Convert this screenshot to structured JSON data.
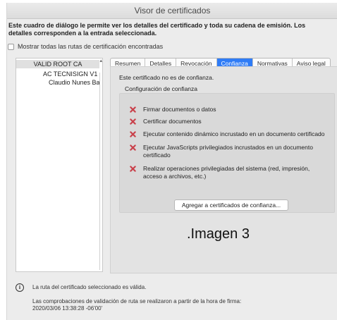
{
  "window": {
    "title": "Visor de certificados"
  },
  "intro": "Este cuadro de diálogo le permite ver los detalles del certificado y toda su cadena de emisión. Los detalles corresponden a la entrada seleccionada.",
  "show_all_paths": {
    "label": "Mostrar todas las rutas de certificación encontradas",
    "checked": false
  },
  "tree": {
    "nodes": [
      "VALID ROOT CA",
      "AC TECNISIGN V1",
      "Claudio Nunes Ba"
    ]
  },
  "tabs": [
    {
      "label": "Resumen",
      "active": false
    },
    {
      "label": "Detalles",
      "active": false
    },
    {
      "label": "Revocación",
      "active": false
    },
    {
      "label": "Confianza",
      "active": true
    },
    {
      "label": "Normativas",
      "active": false
    },
    {
      "label": "Aviso legal",
      "active": false
    }
  ],
  "trust": {
    "not_trusted": "Este certificado no es de confianza.",
    "config_label": "Configuración de confianza",
    "items": [
      "Firmar documentos o datos",
      "Certificar documentos",
      "Ejecutar contenido dinámico incrustado en un documento certificado",
      "Ejecutar JavaScripts privilegiados incrustados en un documento certificado",
      "Realizar operaciones privilegiadas del sistema (red, impresión, acceso a archivos, etc.)"
    ],
    "item_icon": "red-x-icon",
    "add_button": "Agregar a certificados de confianza..."
  },
  "caption": ".Imagen 3",
  "status": {
    "icon": "info-icon",
    "valid": "La ruta del certificado seleccionado es válida.",
    "checks": "Las comprobaciones de validación de ruta se realizaron a partir de la hora de firma: 2020/03/06 13:38:28 -06'00'"
  },
  "colors": {
    "accent": "#2f7cf6",
    "x_mark": "#c9404a"
  }
}
